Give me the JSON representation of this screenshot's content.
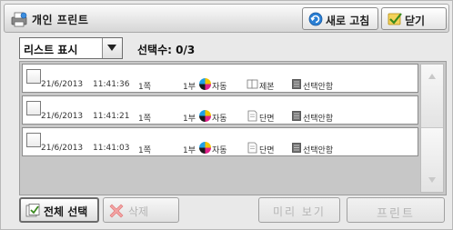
{
  "window": {
    "title": "개인 프린트",
    "refresh_label": "새로 고침",
    "close_label": "닫기"
  },
  "controls": {
    "view_mode": "리스트 표시",
    "selected_count_label": "선택수:",
    "selected_count": "0/3"
  },
  "jobs": [
    {
      "date": "21/6/2013",
      "time": "11:41:36",
      "pages": "1쪽",
      "copies": "1부",
      "color": "자동",
      "sides": "제본",
      "status": "선택안함"
    },
    {
      "date": "21/6/2013",
      "time": "11:41:21",
      "pages": "1쪽",
      "copies": "1부",
      "color": "자동",
      "sides": "단면",
      "status": "선택안함"
    },
    {
      "date": "21/6/2013",
      "time": "11:41:03",
      "pages": "1쪽",
      "copies": "1부",
      "color": "자동",
      "sides": "단면",
      "status": "선택안함"
    }
  ],
  "buttons": {
    "select_all": "전체 선택",
    "delete": "삭제",
    "preview": "미리 보기",
    "print": "프린트"
  },
  "icons": {
    "title": "printer-person-icon",
    "refresh": "refresh-icon",
    "close": "checkmark-icon",
    "color_mode": "color-mode-icon",
    "sides_booklet": "booklet-icon",
    "sides_simplex": "single-sided-icon",
    "status": "unselected-status-icon",
    "select_all": "select-all-icon",
    "delete": "delete-x-icon"
  },
  "colors": {
    "accent_blue": "#2a7fd4",
    "check_green": "#5aa62c",
    "delete_red": "#e25a5a",
    "disabled_text": "#b5b5b5"
  }
}
